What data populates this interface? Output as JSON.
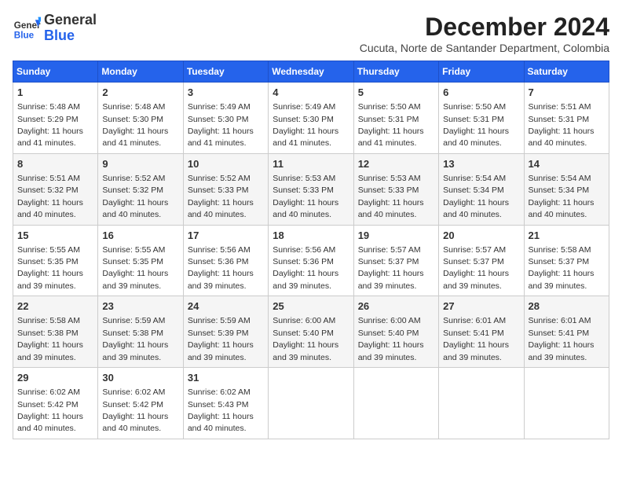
{
  "header": {
    "logo_general": "General",
    "logo_blue": "Blue",
    "month_title": "December 2024",
    "location": "Cucuta, Norte de Santander Department, Colombia"
  },
  "days_of_week": [
    "Sunday",
    "Monday",
    "Tuesday",
    "Wednesday",
    "Thursday",
    "Friday",
    "Saturday"
  ],
  "weeks": [
    [
      {
        "day": "1",
        "sunrise": "5:48 AM",
        "sunset": "5:29 PM",
        "daylight": "11 hours and 41 minutes."
      },
      {
        "day": "2",
        "sunrise": "5:48 AM",
        "sunset": "5:30 PM",
        "daylight": "11 hours and 41 minutes."
      },
      {
        "day": "3",
        "sunrise": "5:49 AM",
        "sunset": "5:30 PM",
        "daylight": "11 hours and 41 minutes."
      },
      {
        "day": "4",
        "sunrise": "5:49 AM",
        "sunset": "5:30 PM",
        "daylight": "11 hours and 41 minutes."
      },
      {
        "day": "5",
        "sunrise": "5:50 AM",
        "sunset": "5:31 PM",
        "daylight": "11 hours and 41 minutes."
      },
      {
        "day": "6",
        "sunrise": "5:50 AM",
        "sunset": "5:31 PM",
        "daylight": "11 hours and 40 minutes."
      },
      {
        "day": "7",
        "sunrise": "5:51 AM",
        "sunset": "5:31 PM",
        "daylight": "11 hours and 40 minutes."
      }
    ],
    [
      {
        "day": "8",
        "sunrise": "5:51 AM",
        "sunset": "5:32 PM",
        "daylight": "11 hours and 40 minutes."
      },
      {
        "day": "9",
        "sunrise": "5:52 AM",
        "sunset": "5:32 PM",
        "daylight": "11 hours and 40 minutes."
      },
      {
        "day": "10",
        "sunrise": "5:52 AM",
        "sunset": "5:33 PM",
        "daylight": "11 hours and 40 minutes."
      },
      {
        "day": "11",
        "sunrise": "5:53 AM",
        "sunset": "5:33 PM",
        "daylight": "11 hours and 40 minutes."
      },
      {
        "day": "12",
        "sunrise": "5:53 AM",
        "sunset": "5:33 PM",
        "daylight": "11 hours and 40 minutes."
      },
      {
        "day": "13",
        "sunrise": "5:54 AM",
        "sunset": "5:34 PM",
        "daylight": "11 hours and 40 minutes."
      },
      {
        "day": "14",
        "sunrise": "5:54 AM",
        "sunset": "5:34 PM",
        "daylight": "11 hours and 40 minutes."
      }
    ],
    [
      {
        "day": "15",
        "sunrise": "5:55 AM",
        "sunset": "5:35 PM",
        "daylight": "11 hours and 39 minutes."
      },
      {
        "day": "16",
        "sunrise": "5:55 AM",
        "sunset": "5:35 PM",
        "daylight": "11 hours and 39 minutes."
      },
      {
        "day": "17",
        "sunrise": "5:56 AM",
        "sunset": "5:36 PM",
        "daylight": "11 hours and 39 minutes."
      },
      {
        "day": "18",
        "sunrise": "5:56 AM",
        "sunset": "5:36 PM",
        "daylight": "11 hours and 39 minutes."
      },
      {
        "day": "19",
        "sunrise": "5:57 AM",
        "sunset": "5:37 PM",
        "daylight": "11 hours and 39 minutes."
      },
      {
        "day": "20",
        "sunrise": "5:57 AM",
        "sunset": "5:37 PM",
        "daylight": "11 hours and 39 minutes."
      },
      {
        "day": "21",
        "sunrise": "5:58 AM",
        "sunset": "5:37 PM",
        "daylight": "11 hours and 39 minutes."
      }
    ],
    [
      {
        "day": "22",
        "sunrise": "5:58 AM",
        "sunset": "5:38 PM",
        "daylight": "11 hours and 39 minutes."
      },
      {
        "day": "23",
        "sunrise": "5:59 AM",
        "sunset": "5:38 PM",
        "daylight": "11 hours and 39 minutes."
      },
      {
        "day": "24",
        "sunrise": "5:59 AM",
        "sunset": "5:39 PM",
        "daylight": "11 hours and 39 minutes."
      },
      {
        "day": "25",
        "sunrise": "6:00 AM",
        "sunset": "5:40 PM",
        "daylight": "11 hours and 39 minutes."
      },
      {
        "day": "26",
        "sunrise": "6:00 AM",
        "sunset": "5:40 PM",
        "daylight": "11 hours and 39 minutes."
      },
      {
        "day": "27",
        "sunrise": "6:01 AM",
        "sunset": "5:41 PM",
        "daylight": "11 hours and 39 minutes."
      },
      {
        "day": "28",
        "sunrise": "6:01 AM",
        "sunset": "5:41 PM",
        "daylight": "11 hours and 39 minutes."
      }
    ],
    [
      {
        "day": "29",
        "sunrise": "6:02 AM",
        "sunset": "5:42 PM",
        "daylight": "11 hours and 40 minutes."
      },
      {
        "day": "30",
        "sunrise": "6:02 AM",
        "sunset": "5:42 PM",
        "daylight": "11 hours and 40 minutes."
      },
      {
        "day": "31",
        "sunrise": "6:02 AM",
        "sunset": "5:43 PM",
        "daylight": "11 hours and 40 minutes."
      },
      null,
      null,
      null,
      null
    ]
  ]
}
